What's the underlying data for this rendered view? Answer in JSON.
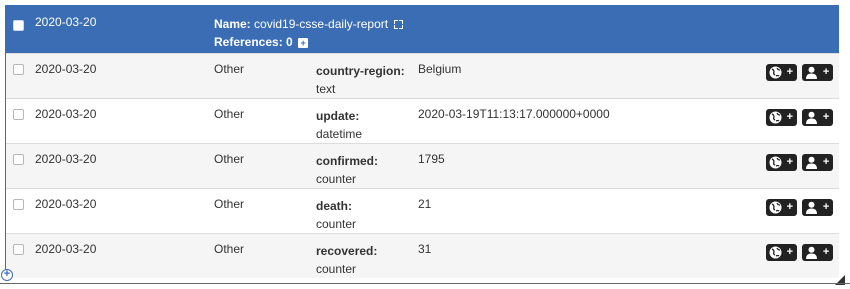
{
  "header": {
    "date": "2020-03-20",
    "name_label": "Name:",
    "name_value": "covid19-csse-daily-report",
    "refs_label": "References:",
    "refs_value": "0",
    "plus_glyph": "+"
  },
  "rows": [
    {
      "date": "2020-03-20",
      "source": "Other",
      "field": "country-region:",
      "type": "text",
      "value": "Belgium"
    },
    {
      "date": "2020-03-20",
      "source": "Other",
      "field": "update:",
      "type": "datetime",
      "value": "2020-03-19T11:13:17.000000+0000"
    },
    {
      "date": "2020-03-20",
      "source": "Other",
      "field": "confirmed:",
      "type": "counter",
      "value": "1795"
    },
    {
      "date": "2020-03-20",
      "source": "Other",
      "field": "death:",
      "type": "counter",
      "value": "21"
    },
    {
      "date": "2020-03-20",
      "source": "Other",
      "field": "recovered:",
      "type": "counter",
      "value": "31"
    }
  ],
  "actions": {
    "plus_glyph": "+"
  },
  "icons": {
    "globe": "globe-icon",
    "user": "user-icon",
    "expand": "expand-icon",
    "add": "add-circle-icon"
  },
  "colors": {
    "header_bg": "#3a6db4",
    "alt_row": "#f5f5f5",
    "button_bg": "#222222"
  }
}
